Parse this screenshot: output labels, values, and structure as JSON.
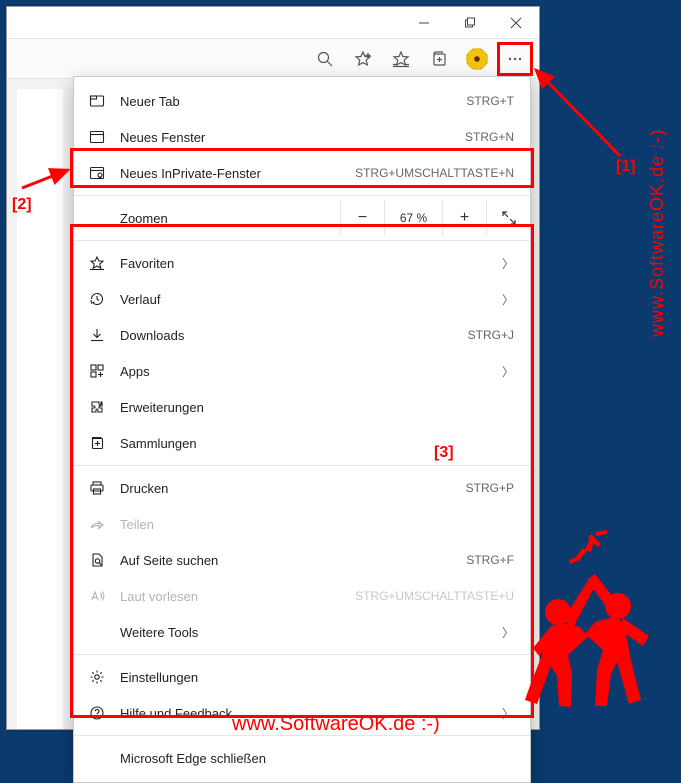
{
  "titlebar": {
    "minimize": "Minimize",
    "maximize": "Maximize",
    "close": "Close"
  },
  "toolbar": {
    "zoom_icon": "zoom",
    "fav_add": "add-favorite",
    "favorites": "favorites",
    "collections": "collections",
    "profile": "profile",
    "more": "more"
  },
  "menu": {
    "new_tab": {
      "label": "Neuer Tab",
      "shortcut": "STRG+T"
    },
    "new_window": {
      "label": "Neues Fenster",
      "shortcut": "STRG+N"
    },
    "inprivate": {
      "label": "Neues InPrivate-Fenster",
      "shortcut": "STRG+UMSCHALTTASTE+N"
    },
    "zoom": {
      "label": "Zoomen",
      "value": "67 %",
      "dec": "−",
      "inc": "+",
      "full": "⤢"
    },
    "favorites": {
      "label": "Favoriten"
    },
    "history": {
      "label": "Verlauf"
    },
    "downloads": {
      "label": "Downloads",
      "shortcut": "STRG+J"
    },
    "apps": {
      "label": "Apps"
    },
    "extensions": {
      "label": "Erweiterungen"
    },
    "collections": {
      "label": "Sammlungen"
    },
    "print": {
      "label": "Drucken",
      "shortcut": "STRG+P"
    },
    "share": {
      "label": "Teilen"
    },
    "find": {
      "label": "Auf Seite suchen",
      "shortcut": "STRG+F"
    },
    "read_aloud": {
      "label": "Laut vorlesen",
      "shortcut": "STRG+UMSCHALTTASTE+U"
    },
    "more_tools": {
      "label": "Weitere Tools"
    },
    "settings": {
      "label": "Einstellungen"
    },
    "help": {
      "label": "Hilfe und Feedback"
    },
    "close_edge": {
      "label": "Microsoft Edge schließen"
    }
  },
  "annotations": {
    "a1": "[1]",
    "a2": "[2]",
    "a3": "[3]",
    "watermark": "www.SoftwareOK.de :-)"
  }
}
